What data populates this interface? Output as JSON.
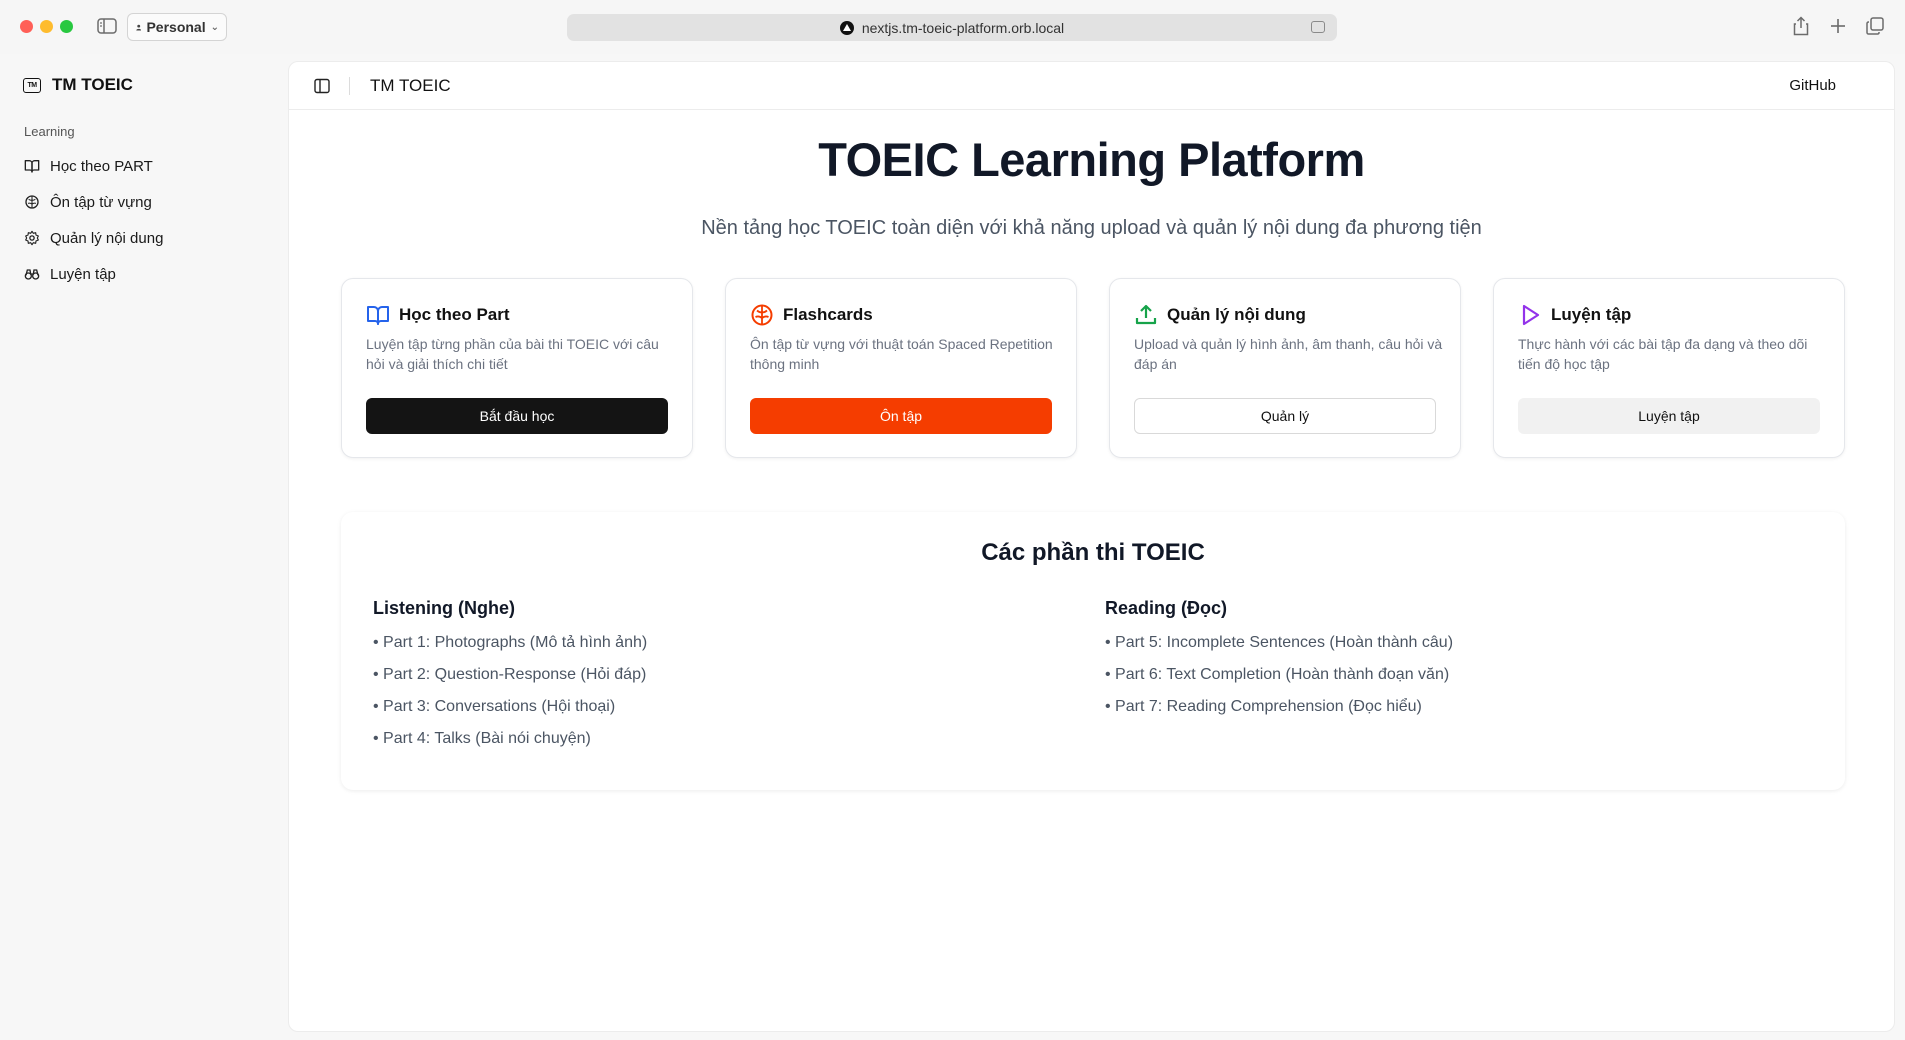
{
  "browser": {
    "profile": "Personal",
    "url": "nextjs.tm-toeic-platform.orb.local"
  },
  "sidebar": {
    "brand": "TM TOEIC",
    "brand_icon_text": "TM",
    "group_label": "Learning",
    "items": [
      {
        "label": "Học theo PART",
        "icon": "book-open-icon"
      },
      {
        "label": "Ôn tập từ vựng",
        "icon": "brain-icon"
      },
      {
        "label": "Quản lý nội dung",
        "icon": "gear-icon"
      },
      {
        "label": "Luyện tập",
        "icon": "binoculars-icon"
      }
    ]
  },
  "header": {
    "title": "TM TOEIC",
    "github": "GitHub"
  },
  "hero": {
    "title": "TOEIC Learning Platform",
    "subtitle": "Nền tảng học TOEIC toàn diện với khả năng upload và quản lý nội dung đa phương tiện"
  },
  "cards": [
    {
      "title": "Học theo Part",
      "desc": "Luyện tập từng phần của bài thi TOEIC với câu hỏi và giải thích chi tiết",
      "button": "Bắt đầu học",
      "icon": "book-open-icon",
      "icon_color": "#2563eb"
    },
    {
      "title": "Flashcards",
      "desc": "Ôn tập từ vựng với thuật toán Spaced Repetition thông minh",
      "button": "Ôn tập",
      "icon": "brain-icon",
      "icon_color": "#f53d00"
    },
    {
      "title": "Quản lý nội dung",
      "desc": "Upload và quản lý hình ảnh, âm thanh, câu hỏi và đáp án",
      "button": "Quản lý",
      "icon": "upload-icon",
      "icon_color": "#16a34a"
    },
    {
      "title": "Luyện tập",
      "desc": "Thực hành với các bài tập đa dạng và theo dõi tiến độ học tập",
      "button": "Luyện tập",
      "icon": "play-icon",
      "icon_color": "#9333ea"
    }
  ],
  "parts": {
    "title": "Các phần thi TOEIC",
    "listening": {
      "title": "Listening (Nghe)",
      "items": [
        "• Part 1: Photographs (Mô tả hình ảnh)",
        "• Part 2: Question-Response (Hỏi đáp)",
        "• Part 3: Conversations (Hội thoại)",
        "• Part 4: Talks (Bài nói chuyện)"
      ]
    },
    "reading": {
      "title": "Reading (Đọc)",
      "items": [
        "• Part 5: Incomplete Sentences (Hoàn thành câu)",
        "• Part 6: Text Completion (Hoàn thành đoạn văn)",
        "• Part 7: Reading Comprehension (Đọc hiểu)"
      ]
    }
  }
}
